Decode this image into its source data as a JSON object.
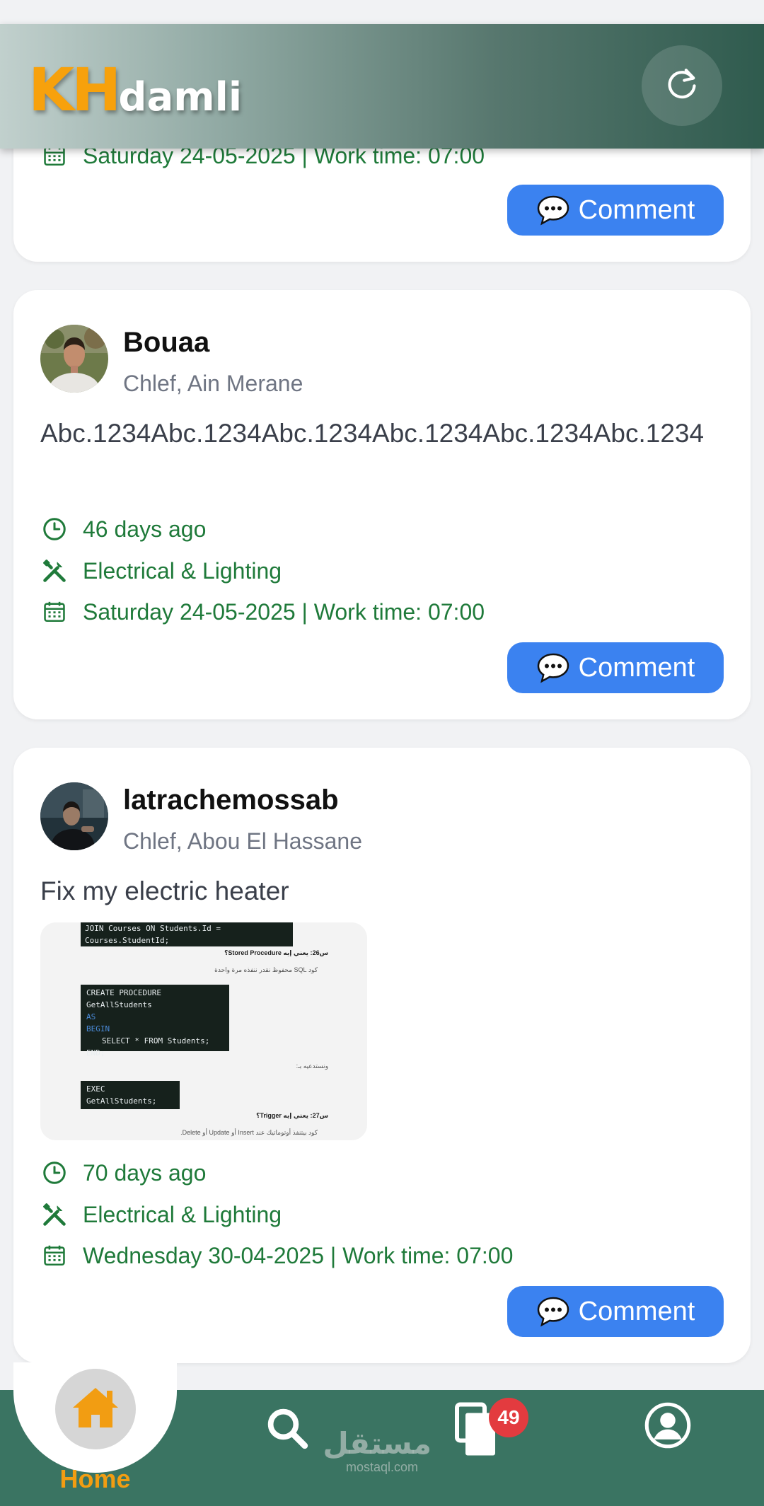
{
  "app": {
    "logo_kh": "KH",
    "logo_rest": "damli"
  },
  "posts": [
    {
      "date_line": "Saturday 24-05-2025 | Work time: 07:00",
      "comment_label": "Comment"
    },
    {
      "user_name": "Bouaa",
      "location": "Chlef, Ain Merane",
      "description": "Abc.1234Abc.1234Abc.1234Abc.1234Abc.1234Abc.1234",
      "time_ago": "46 days ago",
      "category": "Electrical & Lighting",
      "date_line": "Saturday 24-05-2025 | Work time: 07:00",
      "comment_label": "Comment"
    },
    {
      "user_name": "latrachemossab",
      "location": "Chlef, Abou El Hassane",
      "description": "Fix my electric heater",
      "image": {
        "line1": "JOIN Courses ON Students.Id = Courses.StudentId;",
        "heading1": "س26: يعني إيه Stored Procedure؟",
        "bullet1": "كود SQL محفوظ نقدر ننفذه مرة واحدة",
        "proc_line1": "CREATE PROCEDURE GetAllStudents",
        "proc_line2": "AS",
        "proc_line3": "BEGIN",
        "proc_line4": "SELECT * FROM Students;",
        "proc_line5": "END;",
        "call_note": "ونستدعيه بـ:",
        "exec_line": "EXEC GetAllStudents;",
        "heading2": "س27: يعني إيه Trigger؟",
        "bullet2": "كود بيتنفذ أوتوماتيك عند Insert أو Update أو Delete."
      },
      "time_ago": "70 days ago",
      "category": "Electrical & Lighting",
      "date_line": "Wednesday 30-04-2025 | Work time: 07:00",
      "comment_label": "Comment"
    }
  ],
  "nav": {
    "home_label": "Home",
    "orders_badge": "49",
    "watermark_ar": "مستقل",
    "watermark_en": "mostaql.com"
  },
  "colors": {
    "accent_orange": "#f7a10c",
    "comment_blue": "#3b82f0",
    "meta_green": "#1f7a3a",
    "nav_green": "#3a7462",
    "badge_red": "#e33b3f"
  },
  "icons": {
    "refresh": "refresh-icon",
    "time": "clock-icon",
    "category": "tools-icon",
    "date": "calendar-icon",
    "comment": "chat-bubble-icon",
    "home": "home-icon",
    "search": "search-icon",
    "orders": "documents-icon",
    "profile": "user-circle-icon"
  }
}
